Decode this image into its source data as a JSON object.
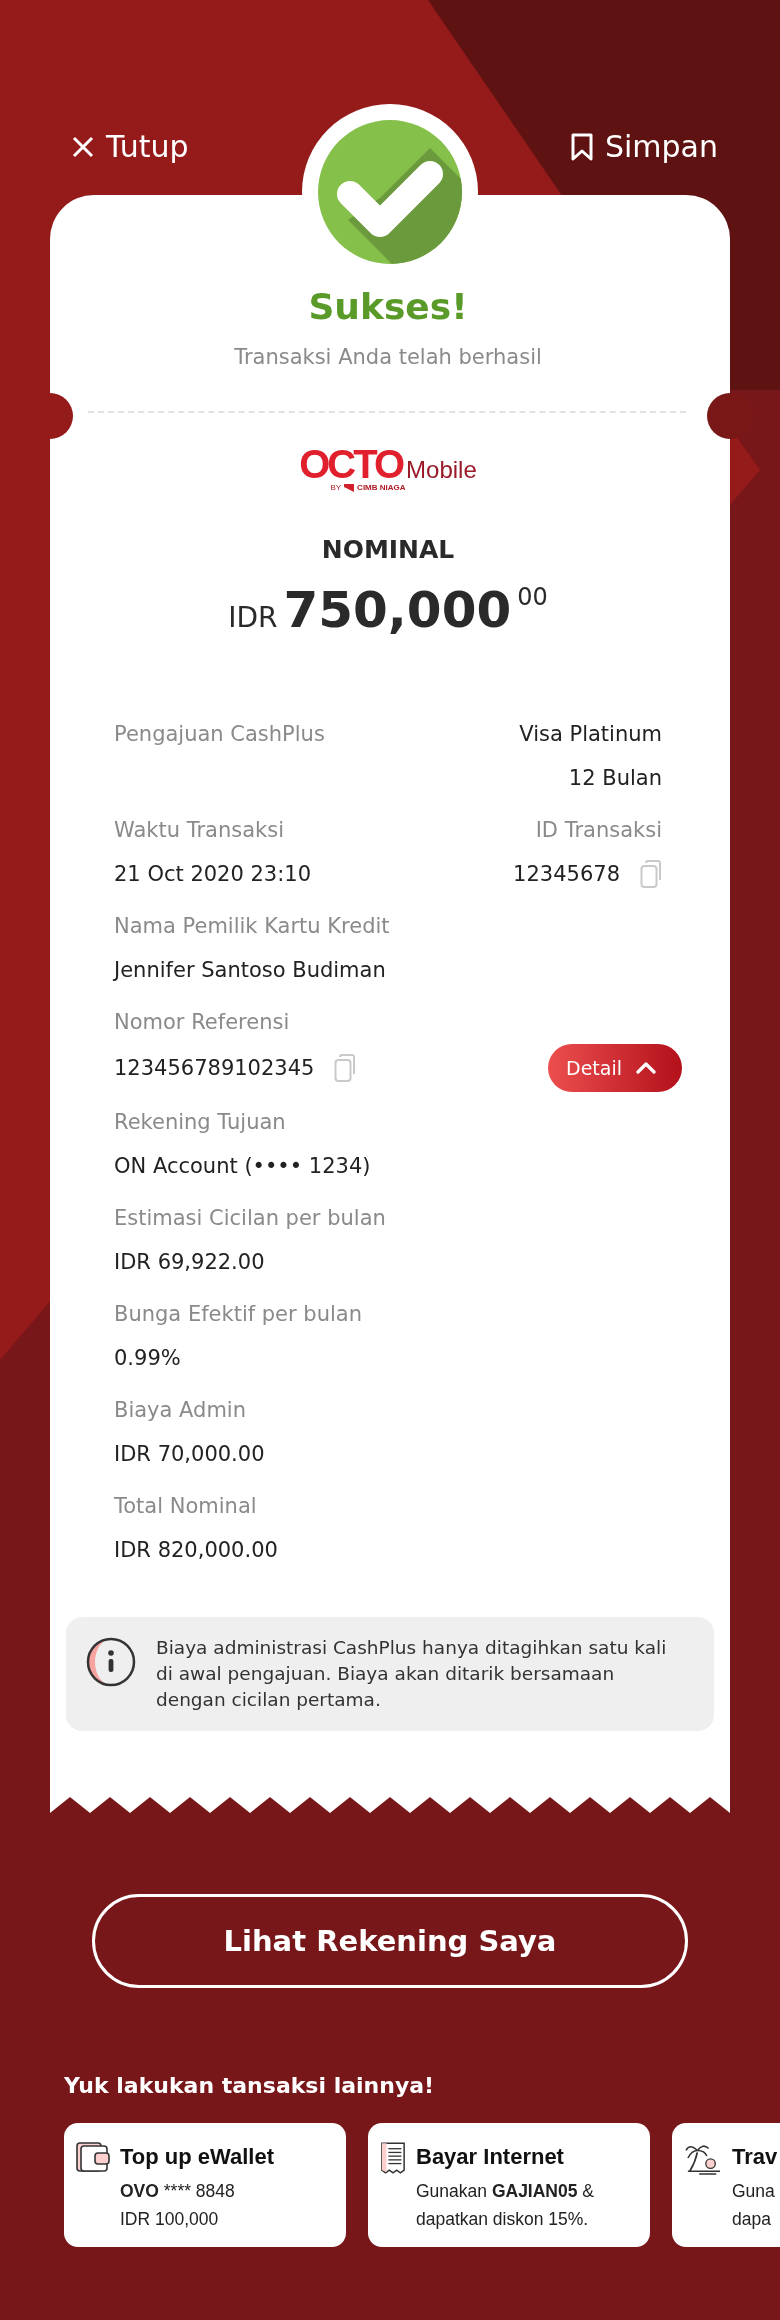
{
  "header": {
    "close": {
      "label": "Tutup"
    },
    "save": {
      "label": "Simpan"
    }
  },
  "status": {
    "kind": "success",
    "title": "Sukses!",
    "subtitle": "Transaksi Anda telah berhasil"
  },
  "logo": {
    "mark": "OCTO",
    "suffix": "Mobile",
    "byline_prefix": "BY",
    "byline_bank": "CIMB NIAGA"
  },
  "amount": {
    "label": "NOMINAL",
    "currency": "IDR",
    "whole": "750,000",
    "cents": "00"
  },
  "details": [
    {
      "kind": "summary",
      "label": "Pengajuan CashPlus",
      "values": [
        "Visa Platinum",
        "12 Bulan"
      ]
    },
    {
      "kind": "split",
      "left": {
        "label": "Waktu Transaksi",
        "value": "21 Oct 2020 23:10",
        "copyable": false
      },
      "right": {
        "label": "ID Transaksi",
        "value": "12345678",
        "copyable": true
      }
    },
    {
      "kind": "field",
      "label": "Nama Pemilik Kartu Kredit",
      "value": "Jennifer Santoso Budiman",
      "copyable": false
    },
    {
      "kind": "field",
      "label": "Nomor Referensi",
      "value": "123456789102345",
      "copyable": true,
      "action": {
        "label": "Detail",
        "expanded": true
      }
    },
    {
      "kind": "field",
      "label": "Rekening Tujuan",
      "value": "ON Account (•••• 1234)",
      "copyable": false
    },
    {
      "kind": "field",
      "label": "Estimasi Cicilan per bulan",
      "value": "IDR 69,922.00",
      "copyable": false
    },
    {
      "kind": "field",
      "label": "Bunga Efektif per bulan",
      "value": "0.99%",
      "copyable": false
    },
    {
      "kind": "field",
      "label": "Biaya Admin",
      "value": "IDR 70,000.00",
      "copyable": false
    },
    {
      "kind": "field",
      "label": "Total Nominal",
      "value": "IDR 820,000.00",
      "copyable": false
    }
  ],
  "notice": {
    "text": "Biaya administrasi CashPlus hanya ditagihkan satu kali di awal pengajuan. Biaya akan ditarik bersamaan dengan cicilan pertama."
  },
  "primary_button": {
    "label": "Lihat Rekening Saya"
  },
  "suggestions": {
    "title": "Yuk lakukan tansaksi lainnya!",
    "cards": [
      {
        "title": "Top up eWallet",
        "lines": [
          [
            {
              "text": "OVO",
              "bold": true
            },
            {
              "text": " **** 8848",
              "bold": false
            }
          ],
          [
            {
              "text": "IDR 100,000",
              "bold": false
            }
          ]
        ]
      },
      {
        "title": "Bayar Internet",
        "lines": [
          [
            {
              "text": "Gunakan ",
              "bold": false
            },
            {
              "text": "GAJIAN05",
              "bold": true
            },
            {
              "text": " &",
              "bold": false
            }
          ],
          [
            {
              "text": "dapatkan diskon 15%.",
              "bold": false
            }
          ]
        ]
      },
      {
        "title": "Trav",
        "lines": [
          [
            {
              "text": "Guna",
              "bold": false
            }
          ],
          [
            {
              "text": "dapa",
              "bold": false
            }
          ]
        ]
      }
    ]
  }
}
